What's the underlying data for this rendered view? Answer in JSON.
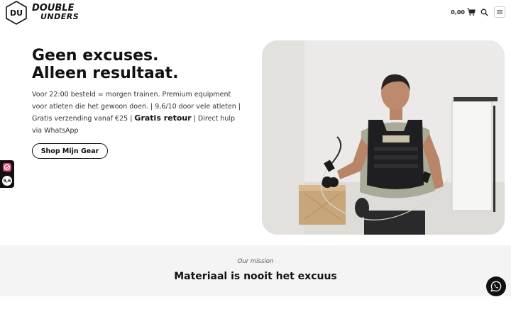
{
  "brand": {
    "logo_mark": "DU",
    "logo_line1": "DOUBLE",
    "logo_line2": "UNDERS"
  },
  "header": {
    "cart_total": "0,00",
    "icons": [
      "cart-icon",
      "search-icon",
      "menu-icon"
    ]
  },
  "hero": {
    "title_line1": "Geen excuses.",
    "title_line2": "Alleen resultaat.",
    "desc_part1": "Voor 22:00 besteld = morgen trainen. Premium equipment voor atleten die het gewoon doen. | 9,6/10 door vele atleten | Gratis verzending vanaf €25 | ",
    "desc_bold": "Gratis retour",
    "desc_part2": " | Direct hulp via WhatsApp",
    "cta_label": "Shop Mijn Gear"
  },
  "side_badge": {
    "rating": "9,6"
  },
  "mission": {
    "kicker": "Our mission",
    "title": "Materiaal is nooit het excuus"
  },
  "colors": {
    "text": "#111111",
    "mission_bg": "#f4f4f4",
    "badge_bg": "#111111",
    "badge_accent": "#e0457b"
  }
}
